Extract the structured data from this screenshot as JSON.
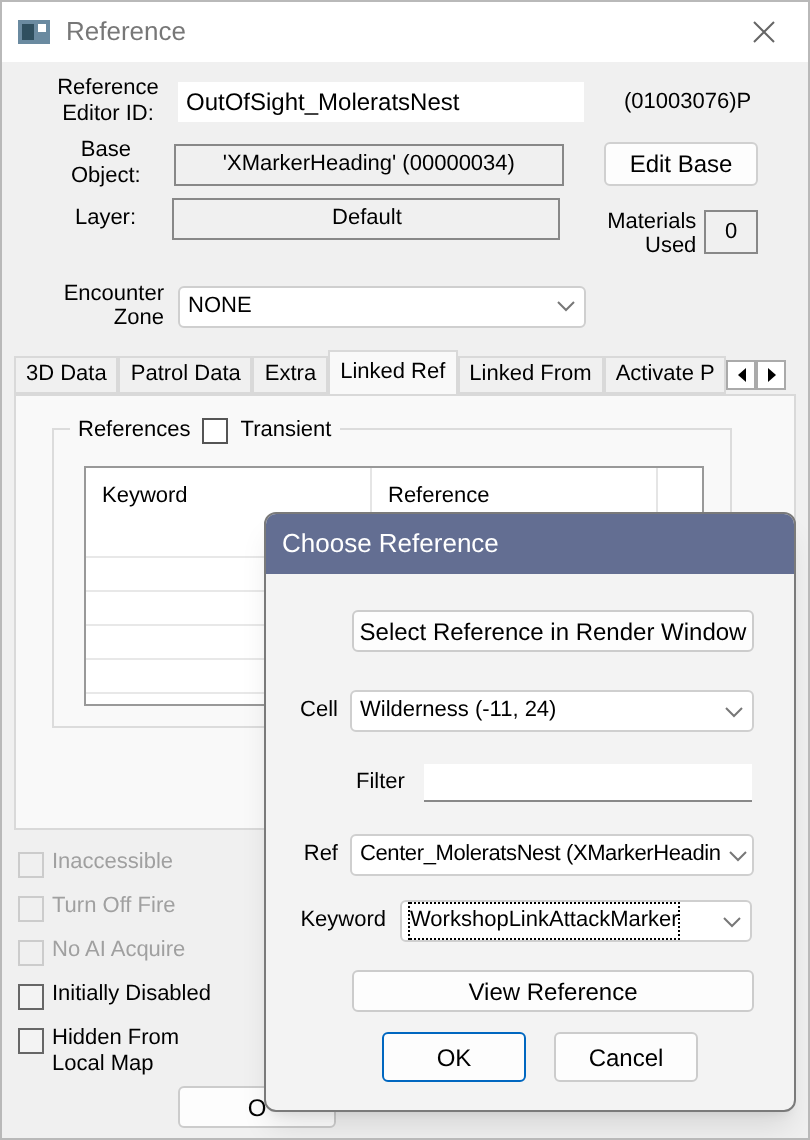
{
  "window": {
    "title": "Reference"
  },
  "editor_id": {
    "label": "Reference Editor ID:",
    "value": "OutOfSight_MoleratsNest",
    "form_id": "(01003076)P"
  },
  "base_object": {
    "label": "Base Object:",
    "value": "'XMarkerHeading' (00000034)",
    "button": "Edit Base"
  },
  "layer": {
    "label": "Layer:",
    "value": "Default"
  },
  "materials_used": {
    "label": "Materials Used",
    "value": "0"
  },
  "encounter_zone": {
    "label": "Encounter Zone",
    "value": "NONE"
  },
  "tabs": [
    {
      "label": "3D Data",
      "selected": false
    },
    {
      "label": "Patrol Data",
      "selected": false
    },
    {
      "label": "Extra",
      "selected": false
    },
    {
      "label": "Linked Ref",
      "selected": true
    },
    {
      "label": "Linked From",
      "selected": false
    },
    {
      "label": "Activate P",
      "selected": false
    }
  ],
  "references": {
    "label": "References",
    "transient": {
      "label": "Transient",
      "checked": false
    },
    "columns": [
      "Keyword",
      "Reference"
    ]
  },
  "flags": [
    {
      "label": "Inaccessible",
      "checked": false,
      "disabled": true
    },
    {
      "label": "Turn Off Fire",
      "checked": false,
      "disabled": true
    },
    {
      "label": "No AI Acquire",
      "checked": false,
      "disabled": true
    },
    {
      "label": "Initially Disabled",
      "checked": false,
      "disabled": false
    },
    {
      "label": "Hidden From Local Map",
      "checked": false,
      "disabled": false
    }
  ],
  "ok_button": "O",
  "dialog": {
    "title": "Choose Reference",
    "select_button": "Select Reference in Render Window",
    "cell": {
      "label": "Cell",
      "value": "Wilderness (-11, 24)"
    },
    "filter": {
      "label": "Filter"
    },
    "ref": {
      "label": "Ref",
      "value": "Center_MoleratsNest (XMarkerHeadin"
    },
    "keyword": {
      "label": "Keyword",
      "value": "WorkshopLinkAttackMarker",
      "focused": true
    },
    "view_button": "View Reference",
    "ok_button": "OK",
    "cancel_button": "Cancel"
  }
}
